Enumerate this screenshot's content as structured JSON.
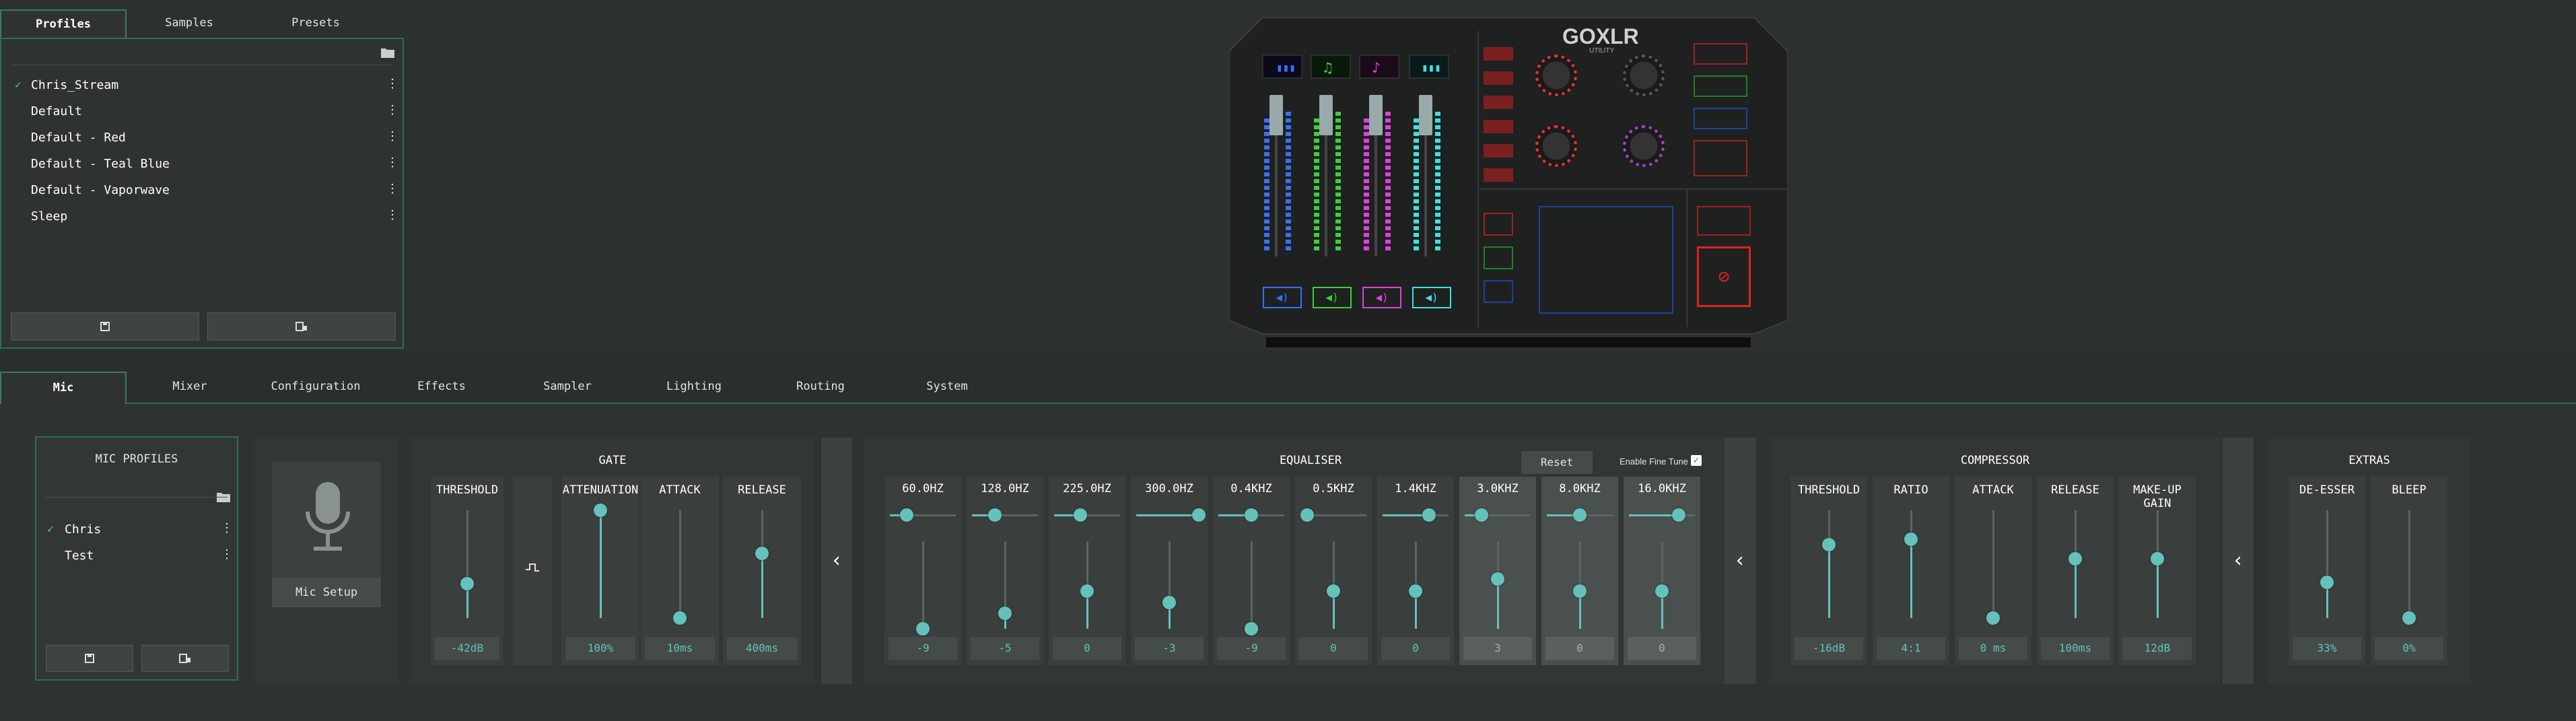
{
  "top_tabs": [
    "Profiles",
    "Samples",
    "Presets"
  ],
  "profiles": {
    "items": [
      {
        "label": "Chris_Stream",
        "active": true
      },
      {
        "label": "Default",
        "active": false
      },
      {
        "label": "Default - Red",
        "active": false
      },
      {
        "label": "Default - Teal Blue",
        "active": false
      },
      {
        "label": "Default - Vaporwave",
        "active": false
      },
      {
        "label": "Sleep",
        "active": false
      }
    ]
  },
  "device": {
    "logo_text": "GOXLR",
    "logo_sub": "UTILITY"
  },
  "main_tabs": [
    "Mic",
    "Mixer",
    "Configuration",
    "Effects",
    "Sampler",
    "Lighting",
    "Routing",
    "System"
  ],
  "mic_profiles": {
    "title": "MIC PROFILES",
    "items": [
      {
        "label": "Chris",
        "active": true
      },
      {
        "label": "Test",
        "active": false
      }
    ]
  },
  "mic_setup": {
    "label": "Mic Setup"
  },
  "gate": {
    "title": "GATE",
    "columns": [
      {
        "label": "THRESHOLD",
        "value": "-42dB",
        "level": 0.32
      },
      {
        "label": "ATTENUATION",
        "value": "100%",
        "level": 1.0
      },
      {
        "label": "ATTACK",
        "value": "10ms",
        "level": 0.0
      },
      {
        "label": "RELEASE",
        "value": "400ms",
        "level": 0.6
      }
    ]
  },
  "equaliser": {
    "title": "EQUALISER",
    "reset_label": "Reset",
    "fine_tune_label": "Enable Fine Tune",
    "bands": [
      {
        "label": "60.0HZ",
        "value": "-9",
        "freq": 0.25,
        "level": 0.0,
        "hl": false
      },
      {
        "label": "128.0HZ",
        "value": "-5",
        "freq": 0.35,
        "level": 0.18,
        "hl": false
      },
      {
        "label": "225.0HZ",
        "value": "0",
        "freq": 0.4,
        "level": 0.43,
        "hl": false
      },
      {
        "label": "300.0HZ",
        "value": "-3",
        "freq": 0.95,
        "level": 0.3,
        "hl": false
      },
      {
        "label": "0.4KHZ",
        "value": "-9",
        "freq": 0.5,
        "level": 0.0,
        "hl": false
      },
      {
        "label": "0.5KHZ",
        "value": "0",
        "freq": 0.1,
        "level": 0.43,
        "hl": false
      },
      {
        "label": "1.4KHZ",
        "value": "0",
        "freq": 0.7,
        "level": 0.43,
        "hl": false
      },
      {
        "label": "3.0KHZ",
        "value": "3",
        "freq": 0.25,
        "level": 0.57,
        "hl": true
      },
      {
        "label": "8.0KHZ",
        "value": "0",
        "freq": 0.5,
        "level": 0.43,
        "hl": true
      },
      {
        "label": "16.0KHZ",
        "value": "0",
        "freq": 0.75,
        "level": 0.43,
        "hl": true
      }
    ]
  },
  "compressor": {
    "title": "COMPRESSOR",
    "columns": [
      {
        "label": "THRESHOLD",
        "value": "-16dB",
        "level": 0.68
      },
      {
        "label": "RATIO",
        "value": "4:1",
        "level": 0.73
      },
      {
        "label": "ATTACK",
        "value": "0 ms",
        "level": 0.0
      },
      {
        "label": "RELEASE",
        "value": "100ms",
        "level": 0.55
      },
      {
        "label": "MAKE-UP GAIN",
        "value": "12dB",
        "level": 0.55
      }
    ]
  },
  "extras": {
    "title": "EXTRAS",
    "columns": [
      {
        "label": "DE-ESSER",
        "value": "33%",
        "level": 0.33
      },
      {
        "label": "BLEEP",
        "value": "0%",
        "level": 0.0
      }
    ]
  },
  "nav": {
    "arrow": "‹"
  },
  "colors": {
    "accent": "#64c2bb",
    "border": "#2f6b5e",
    "bg": "#2a2e2d"
  }
}
